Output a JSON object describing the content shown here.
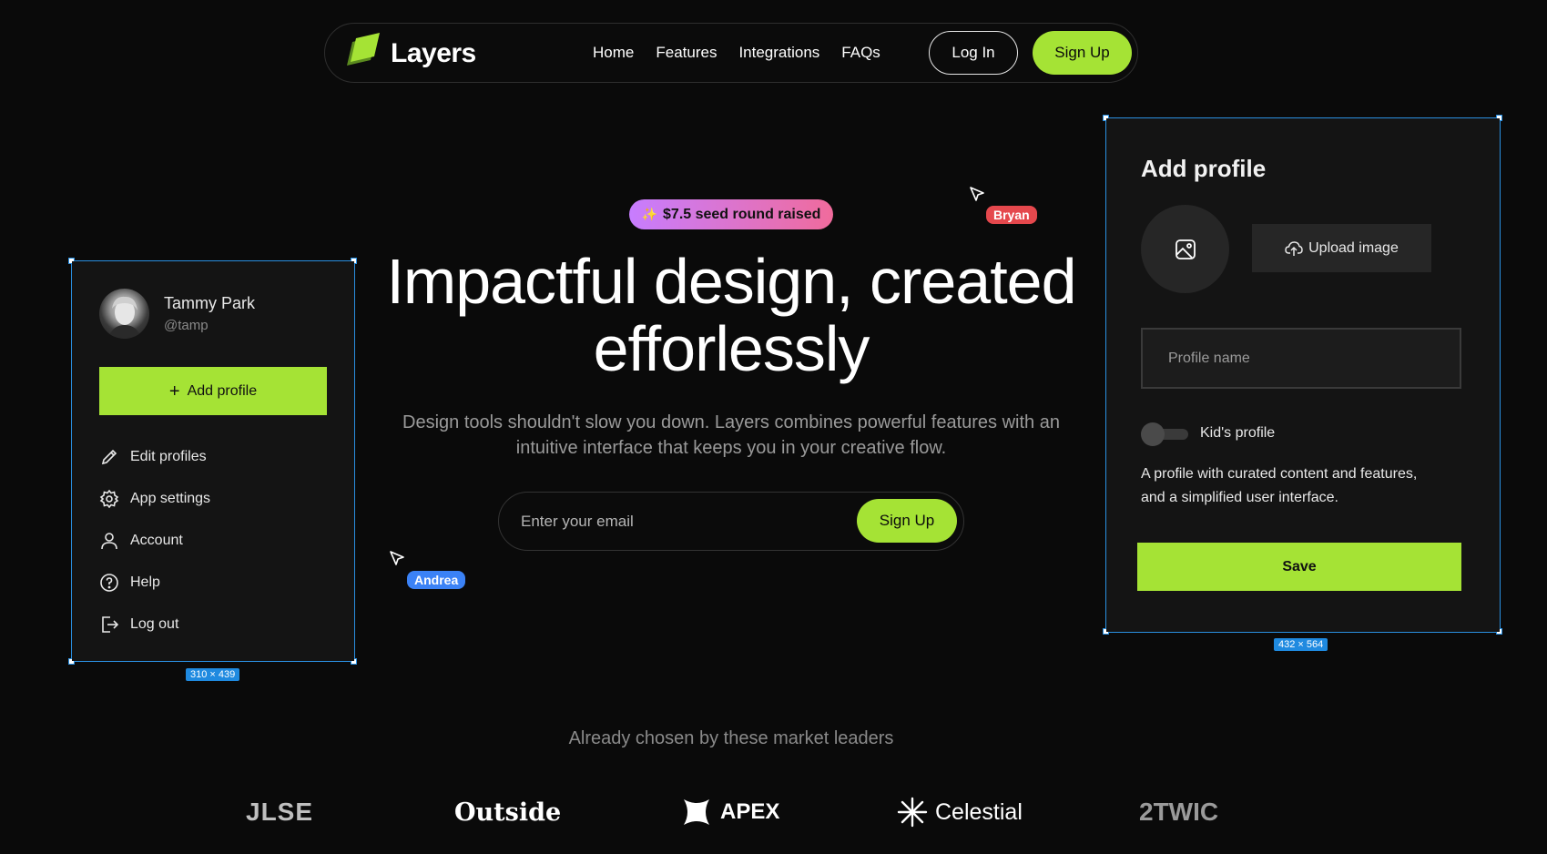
{
  "nav": {
    "brand": "Layers",
    "links": [
      "Home",
      "Features",
      "Integrations",
      "FAQs"
    ],
    "login_label": "Log In",
    "signup_label": "Sign Up"
  },
  "hero": {
    "badge_text": "$7.5 seed round raised",
    "title_line1": "Impactful design, created",
    "title_line2": "efforlessly",
    "subtitle": "Design tools shouldn't slow you down. Layers combines powerful features with an intuitive interface that keeps you in your creative flow.",
    "email_placeholder": "Enter your email",
    "signup_label": "Sign Up"
  },
  "profile_menu": {
    "user_name": "Tammy Park",
    "user_handle": "@tamp",
    "add_profile_label": "Add profile",
    "items": [
      "Edit profiles",
      "App settings",
      "Account",
      "Help",
      "Log out"
    ],
    "dimension_tag": "310 × 439"
  },
  "add_profile": {
    "title": "Add profile",
    "upload_label": "Upload image",
    "name_placeholder": "Profile name",
    "kids_toggle_label": "Kid's profile",
    "kids_toggle_on": false,
    "description": "A profile with curated content and features, and a simplified user interface.",
    "save_label": "Save",
    "dimension_tag": "432 × 564"
  },
  "cursors": [
    {
      "name": "Bryan",
      "color": "#e5484d"
    },
    {
      "name": "Andrea",
      "color": "#3b82f6"
    }
  ],
  "leaders": {
    "heading": "Already chosen by these market leaders",
    "logos": [
      "JLSE",
      "Outside",
      "APEX",
      "Celestial",
      "2TWIC"
    ]
  },
  "colors": {
    "accent": "#a5e335",
    "background": "#0a0a0a",
    "selection": "#2a8fe0"
  }
}
